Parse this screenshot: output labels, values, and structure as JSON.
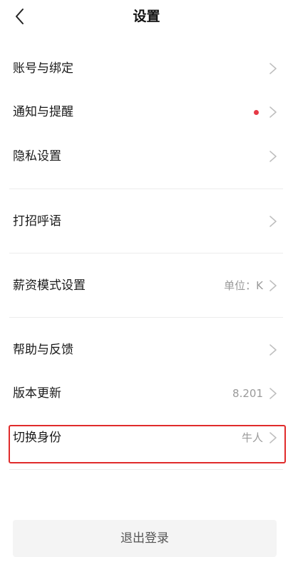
{
  "header": {
    "title": "设置",
    "back_icon": "chevron-left-icon"
  },
  "settings": {
    "account": {
      "label": "账号与绑定"
    },
    "notifications": {
      "label": "通知与提醒",
      "has_unread_dot": true
    },
    "privacy": {
      "label": "隐私设置"
    },
    "greeting": {
      "label": "打招呼语"
    },
    "salary_mode": {
      "label": "薪资模式设置",
      "value": "单位：K"
    },
    "help": {
      "label": "帮助与反馈"
    },
    "version": {
      "label": "版本更新",
      "value": "8.201"
    },
    "switch_identity": {
      "label": "切换身份",
      "value": "牛人"
    }
  },
  "logout": {
    "label": "退出登录"
  },
  "colors": {
    "accent_dot": "#e63946",
    "highlight_border": "#e02b2b",
    "secondary_text": "#9a9a9a"
  }
}
